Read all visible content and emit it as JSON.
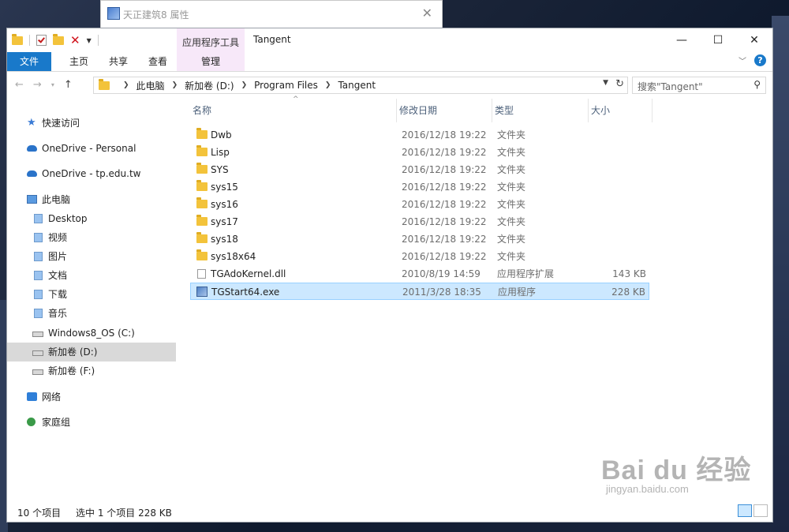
{
  "background_window": {
    "title": "天正建筑8 属性",
    "close": "✕"
  },
  "window": {
    "title": "Tangent",
    "context_tab_group": "应用程序工具",
    "caption": {
      "minimize": "—",
      "maximize": "☐",
      "close": "✕"
    }
  },
  "ribbon": {
    "tabs": [
      "文件",
      "主页",
      "共享",
      "查看",
      "管理"
    ],
    "help": "?"
  },
  "address": {
    "breadcrumbs": [
      "此电脑",
      "新加卷 (D:)",
      "Program Files",
      "Tangent"
    ],
    "search_placeholder": "搜索\"Tangent\""
  },
  "sidebar": {
    "items": [
      {
        "label": "快速访问",
        "icon": "star-icon"
      },
      {
        "label": "OneDrive - Personal",
        "icon": "cloud-icon"
      },
      {
        "label": "OneDrive - tp.edu.tw",
        "icon": "cloud-icon"
      },
      {
        "label": "此电脑",
        "icon": "computer-icon"
      },
      {
        "label": "Desktop",
        "icon": "desktop-icon"
      },
      {
        "label": "视频",
        "icon": "video-icon"
      },
      {
        "label": "图片",
        "icon": "pictures-icon"
      },
      {
        "label": "文档",
        "icon": "documents-icon"
      },
      {
        "label": "下载",
        "icon": "download-icon"
      },
      {
        "label": "音乐",
        "icon": "music-icon"
      },
      {
        "label": "Windows8_OS (C:)",
        "icon": "drive-icon"
      },
      {
        "label": "新加卷 (D:)",
        "icon": "drive-icon"
      },
      {
        "label": "新加卷 (F:)",
        "icon": "drive-icon"
      },
      {
        "label": "网络",
        "icon": "network-icon"
      },
      {
        "label": "家庭组",
        "icon": "homegroup-icon"
      }
    ],
    "selected": "新加卷 (D:)"
  },
  "columns": {
    "name": "名称",
    "date": "修改日期",
    "type": "类型",
    "size": "大小"
  },
  "files": [
    {
      "name": "Dwb",
      "date": "2016/12/18 19:22",
      "type": "文件夹",
      "size": "",
      "kind": "folder"
    },
    {
      "name": "Lisp",
      "date": "2016/12/18 19:22",
      "type": "文件夹",
      "size": "",
      "kind": "folder"
    },
    {
      "name": "SYS",
      "date": "2016/12/18 19:22",
      "type": "文件夹",
      "size": "",
      "kind": "folder"
    },
    {
      "name": "sys15",
      "date": "2016/12/18 19:22",
      "type": "文件夹",
      "size": "",
      "kind": "folder"
    },
    {
      "name": "sys16",
      "date": "2016/12/18 19:22",
      "type": "文件夹",
      "size": "",
      "kind": "folder"
    },
    {
      "name": "sys17",
      "date": "2016/12/18 19:22",
      "type": "文件夹",
      "size": "",
      "kind": "folder"
    },
    {
      "name": "sys18",
      "date": "2016/12/18 19:22",
      "type": "文件夹",
      "size": "",
      "kind": "folder"
    },
    {
      "name": "sys18x64",
      "date": "2016/12/18 19:22",
      "type": "文件夹",
      "size": "",
      "kind": "folder"
    },
    {
      "name": "TGAdoKernel.dll",
      "date": "2010/8/19 14:59",
      "type": "应用程序扩展",
      "size": "143 KB",
      "kind": "dll"
    },
    {
      "name": "TGStart64.exe",
      "date": "2011/3/28 18:35",
      "type": "应用程序",
      "size": "228 KB",
      "kind": "exe",
      "selected": true
    }
  ],
  "status": {
    "count": "10 个项目",
    "selection": "选中 1 个项目  228 KB"
  },
  "watermark": {
    "brand": "Bai du 经验",
    "url": "jingyan.baidu.com"
  },
  "colors": {
    "accent": "#1979ca",
    "context_tab": "#f7e8f9",
    "selection": "#cce8ff",
    "folder": "#f3c33b"
  }
}
